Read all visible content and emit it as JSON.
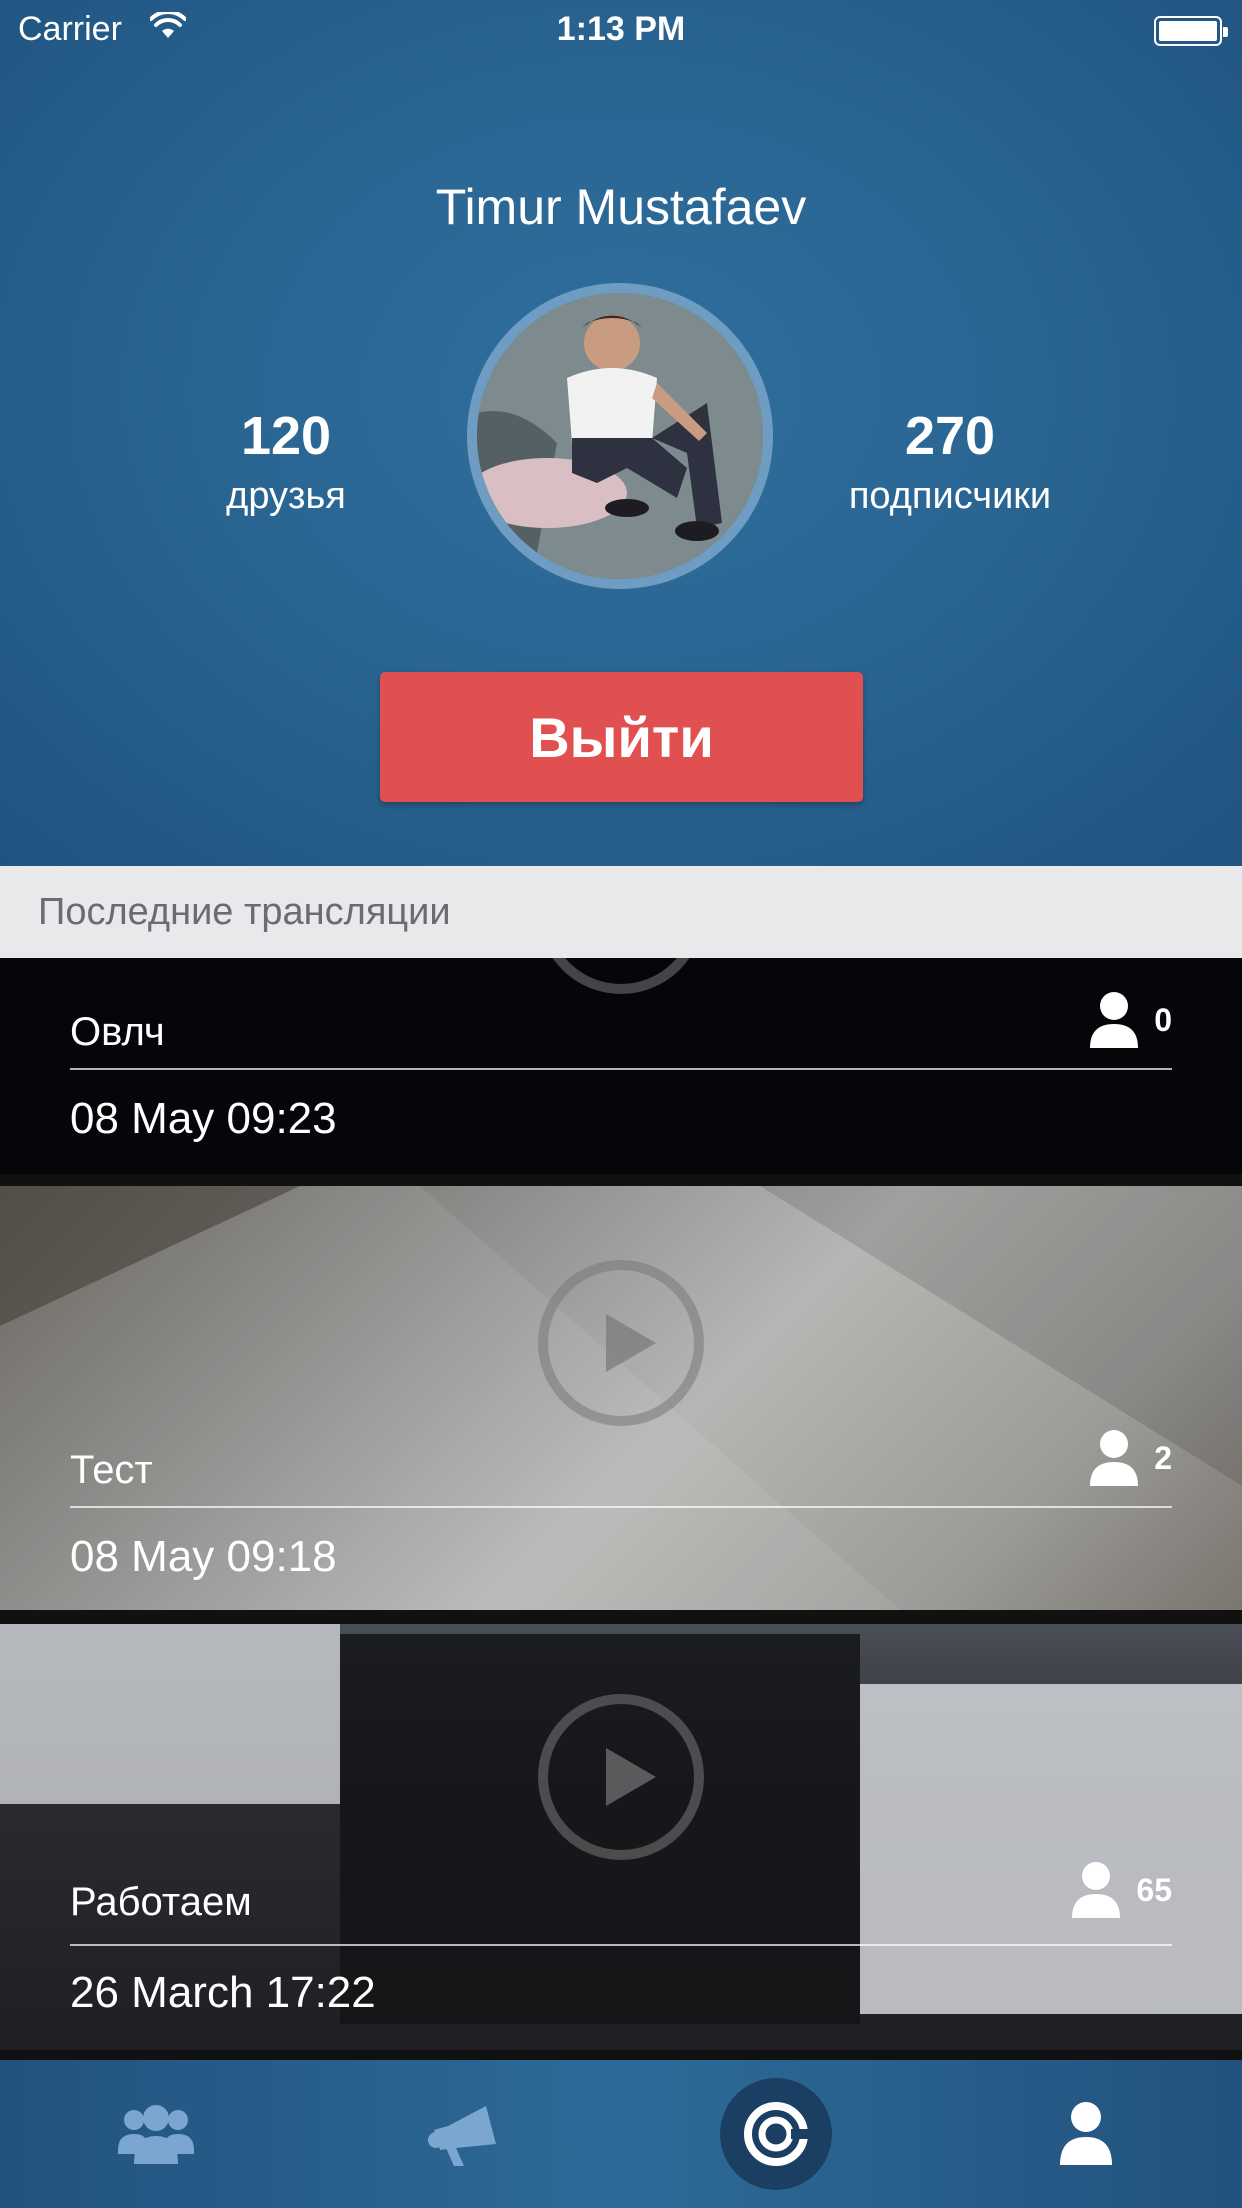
{
  "status_bar": {
    "carrier": "Carrier",
    "time": "1:13 PM"
  },
  "profile": {
    "name": "Timur Mustafaev",
    "friends_count": "120",
    "friends_label": "друзья",
    "followers_count": "270",
    "followers_label": "подписчики",
    "logout_label": "Выйти"
  },
  "section_title": "Последние трансляции",
  "broadcasts": [
    {
      "title": "Овлч",
      "date": "08 May 09:23",
      "viewers": "0"
    },
    {
      "title": "Тест",
      "date": "08 May 09:18",
      "viewers": "2"
    },
    {
      "title": "Работаем",
      "date": "26 March 17:22",
      "viewers": "65"
    }
  ],
  "tab_bar": {
    "items": [
      {
        "icon": "friends-icon",
        "active": false
      },
      {
        "icon": "megaphone-icon",
        "active": false
      },
      {
        "icon": "live-broadcast-icon",
        "active": true
      },
      {
        "icon": "profile-icon",
        "active": false
      }
    ]
  },
  "colors": {
    "header_blue": "#2a6592",
    "logout_red": "#e05050",
    "section_bg": "#e9e9ec",
    "tab_icon": "#7aa6cf",
    "tab_active_bg": "#1a3f63"
  }
}
